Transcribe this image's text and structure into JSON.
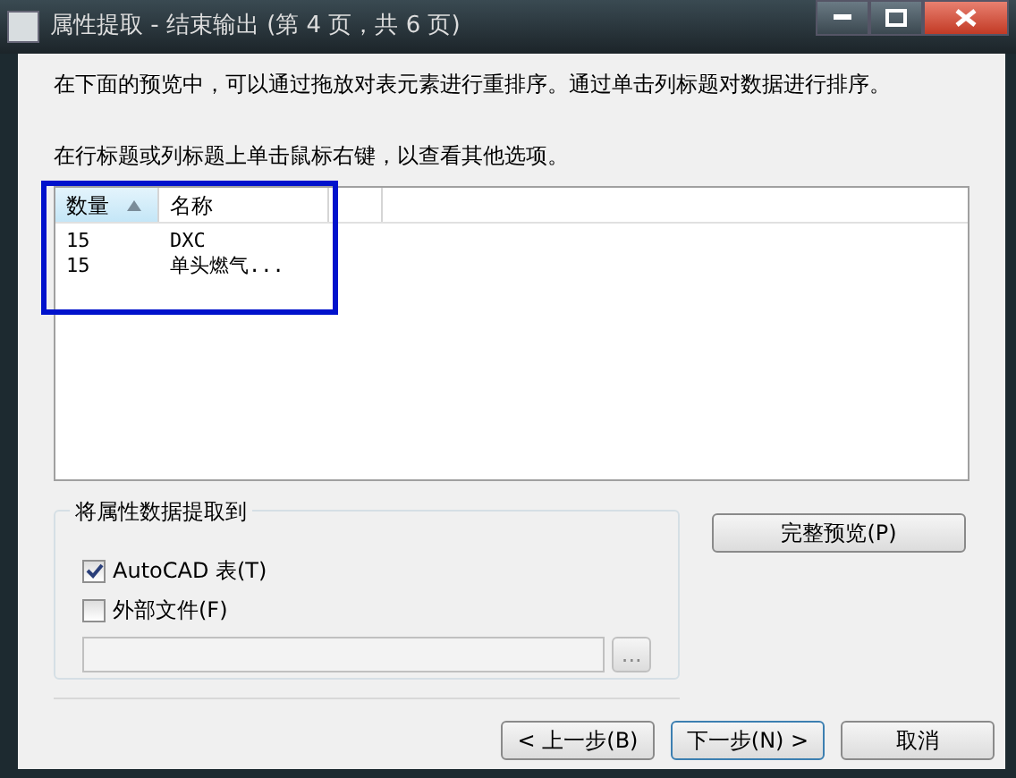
{
  "window": {
    "title": "属性提取 - 结束输出 (第 4 页，共 6 页)"
  },
  "instructions": [
    "在下面的预览中，可以通过拖放对表元素进行重排序。通过单击列标题对数据进行排序。",
    "在行标题或列标题上单击鼠标右键，以查看其他选项。"
  ],
  "table": {
    "columns": [
      {
        "label": "数量",
        "sorted": true
      },
      {
        "label": "名称",
        "sorted": false
      }
    ],
    "rows": [
      [
        "15",
        "DXC"
      ],
      [
        "15",
        "单头燃气..."
      ]
    ]
  },
  "output_group": {
    "title": "将属性数据提取到",
    "options": [
      {
        "label": "AutoCAD 表(T)",
        "checked": true
      },
      {
        "label": "外部文件(F)",
        "checked": false
      }
    ],
    "browse_button": "..."
  },
  "full_preview_button": "完整预览(P)",
  "buttons": [
    "< 上一步(B)",
    "下一步(N) >",
    "取消"
  ]
}
